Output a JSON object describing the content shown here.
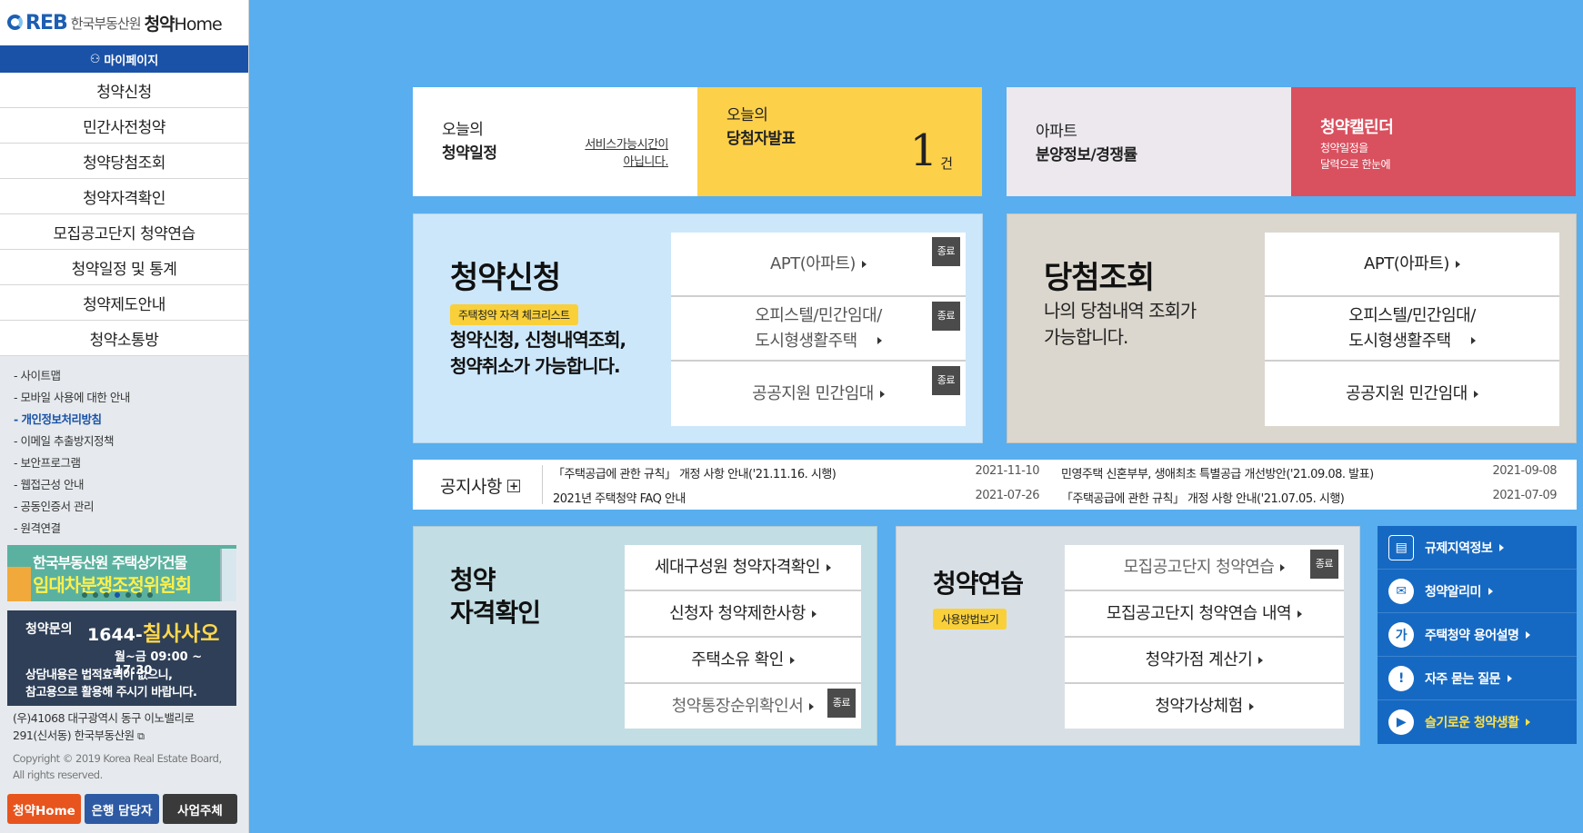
{
  "logo": {
    "reb": "REB",
    "org": "한국부동산원",
    "home_a": "청약",
    "home_b": "Home"
  },
  "sidebar": {
    "mypage": "마이페이지",
    "menu": [
      "청약신청",
      "민간사전청약",
      "청약당첨조회",
      "청약자격확인",
      "모집공고단지 청약연습",
      "청약일정 및 통계",
      "청약제도안내",
      "청약소통방"
    ],
    "links": [
      "- 사이트맵",
      "- 모바일 사용에 대한 안내",
      "- 개인정보처리방침",
      "- 이메일 추출방지정책",
      "- 보안프로그램",
      "- 웹접근성 안내",
      "- 공동인증서 관리",
      "- 원격연결"
    ],
    "active_link_index": 2,
    "banner": {
      "line1": "한국부동산원 주택상가건물",
      "line2": "임대차분쟁조정위원회"
    },
    "call": {
      "label": "청약문의",
      "num_prefix": "1644-",
      "num_word": "칠사사오",
      "hours": "월~금 09:00 ~ 17:30",
      "notice1": "상담내용은 법적효력이 없으니,",
      "notice2": "참고용으로 활용해 주시기 바랍니다."
    },
    "address1": "(우)41068 대구광역시 동구 이노밸리로",
    "address2": "291(신서동) 한국부동산원",
    "copyright1": "Copyright © 2019 Korea Real Estate Board,",
    "copyright2": "All rights reserved.",
    "buttons": [
      {
        "label": "청약Home",
        "color": "#e8541e"
      },
      {
        "label": "은행 담당자",
        "color": "#2d5aa3"
      },
      {
        "label": "사업주체",
        "color": "#3a3a3a"
      }
    ]
  },
  "tiles": {
    "today": {
      "small": "오늘의",
      "big": "청약일정",
      "msg1": "서비스가능시간이",
      "msg2": "아닙니다."
    },
    "winner": {
      "small": "오늘의",
      "big": "당첨자발표",
      "count": "1",
      "unit": "건"
    },
    "apt": {
      "small": "아파트",
      "big": "분양정보/경쟁률"
    },
    "calendar": {
      "big": "청약캘린더",
      "desc1": "청약일정을",
      "desc2": "달력으로 한눈에"
    }
  },
  "apply_panel": {
    "title": "청약신청",
    "badge": "주택청약 자격 체크리스트",
    "desc1": "청약신청, 신청내역조회,",
    "desc2": "청약취소가 가능합니다.",
    "items": [
      {
        "l1": "APT(아파트)",
        "l2": ""
      },
      {
        "l1": "오피스텔/민간임대/",
        "l2": "도시형생활주택"
      },
      {
        "l1": "공공지원 민간임대",
        "l2": ""
      }
    ],
    "end_label": "종료"
  },
  "win_panel": {
    "title": "당첨조회",
    "desc1": "나의 당첨내역 조회가",
    "desc2": "가능합니다.",
    "items": [
      {
        "l1": "APT(아파트)",
        "l2": ""
      },
      {
        "l1": "오피스텔/민간임대/",
        "l2": "도시형생활주택"
      },
      {
        "l1": "공공지원 민간임대",
        "l2": ""
      }
    ]
  },
  "notice": {
    "label": "공지사항",
    "plus": "+",
    "rows": [
      {
        "title": "「주택공급에 관한 규칙」 개정 사항 안내('21.11.16. 시행)",
        "date": "2021-11-10"
      },
      {
        "title": "민영주택 신혼부부, 생애최초 특별공급 개선방안('21.09.08. 발표)",
        "date": "2021-09-08"
      },
      {
        "title": "2021년 주택청약 FAQ 안내",
        "date": "2021-07-26"
      },
      {
        "title": "「주택공급에 관한 규칙」 개정 사항 안내('21.07.05. 시행)",
        "date": "2021-07-09"
      }
    ]
  },
  "check_panel": {
    "title1": "청약",
    "title2": "자격확인",
    "items": [
      "세대구성원 청약자격확인",
      "신청자 청약제한사항",
      "주택소유 확인",
      "청약통장순위확인서"
    ],
    "end_label": "종료"
  },
  "prac_panel": {
    "title": "청약연습",
    "badge": "사용방법보기",
    "items": [
      "모집공고단지 청약연습",
      "모집공고단지 청약연습 내역",
      "청약가점 계산기",
      "청약가상체험"
    ],
    "end_label": "종료"
  },
  "quick": [
    {
      "label": "규제지역정보",
      "icon": "building-doc-icon",
      "glyph": "▤"
    },
    {
      "label": "청약알리미",
      "icon": "mail-icon",
      "glyph": "✉"
    },
    {
      "label": "주택청약 용어설명",
      "icon": "glossary-icon",
      "glyph": "가"
    },
    {
      "label": "자주 묻는 질문",
      "icon": "exclamation-icon",
      "glyph": "!"
    },
    {
      "label": "슬기로운 청약생활",
      "icon": "video-icon",
      "glyph": "▶"
    }
  ]
}
